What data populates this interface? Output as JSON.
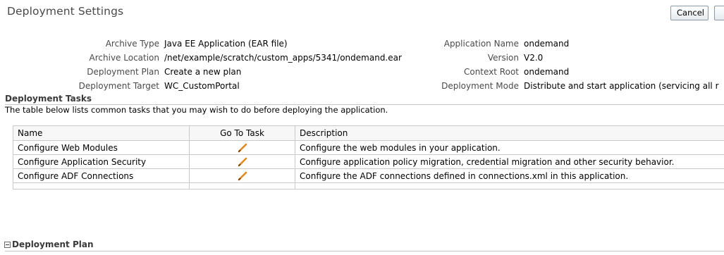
{
  "header": {
    "title": "Deployment Settings",
    "cancel_label": "Cancel",
    "next_label": ""
  },
  "summary": {
    "left": [
      {
        "label": "Archive Type",
        "value": "Java EE Application (EAR file)"
      },
      {
        "label": "Archive Location",
        "value": "/net/example/scratch/custom_apps/5341/ondemand.ear"
      },
      {
        "label": "Deployment Plan",
        "value": "Create a new plan"
      },
      {
        "label": "Deployment Target",
        "value": "WC_CustomPortal"
      }
    ],
    "right": [
      {
        "label": "Application Name",
        "value": "ondemand"
      },
      {
        "label": "Version",
        "value": "V2.0"
      },
      {
        "label": "Context Root",
        "value": "ondemand"
      },
      {
        "label": "Deployment Mode",
        "value": "Distribute and start application (servicing all r"
      }
    ]
  },
  "tasks": {
    "heading": "Deployment Tasks",
    "description": "The table below lists common tasks that you may wish to do before deploying the application.",
    "columns": [
      "Name",
      "Go To Task",
      "Description"
    ],
    "rows": [
      {
        "name": "Configure Web Modules",
        "icon": "pencil-icon",
        "description": "Configure the web modules in your application."
      },
      {
        "name": "Configure Application Security",
        "icon": "pencil-icon",
        "description": "Configure application policy migration, credential migration and other security behavior."
      },
      {
        "name": "Configure ADF Connections",
        "icon": "pencil-icon",
        "description": "Configure the ADF connections defined in connections.xml in this application."
      }
    ]
  },
  "plan": {
    "heading": "Deployment Plan",
    "toggle_icon": "collapse-icon"
  },
  "colors": {
    "title": "#4a4a4a",
    "label": "#4a4a4a",
    "border": "#c9c9c9",
    "pencil": "#e08a1e"
  }
}
